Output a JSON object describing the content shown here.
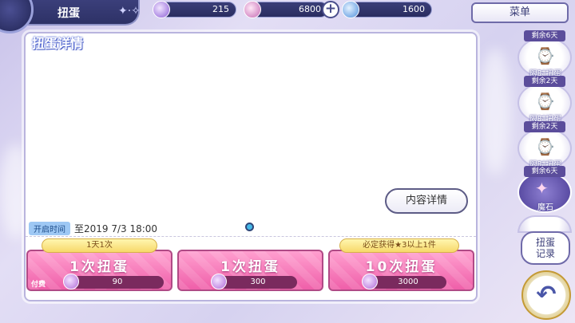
{
  "header": {
    "title": "扭蛋",
    "currencies": [
      {
        "name": "stone",
        "value": "215",
        "color": "#a97ee0"
      },
      {
        "name": "jewel",
        "value": "6800",
        "color": "#d58ec5"
      },
      {
        "name": "potion",
        "value": "1600",
        "color": "#6ea8e6"
      }
    ],
    "menu_label": "菜单"
  },
  "panel": {
    "title": "扭蛋详情",
    "details_button": "内容详情",
    "period_tag": "开启时间",
    "period_text": "至2019 7/3 18:00"
  },
  "gacha": {
    "single_daily": {
      "ribbon": "1天1次",
      "label": "1次扭蛋",
      "pay_tag": "付费",
      "cost": "90"
    },
    "single": {
      "label": "1次扭蛋",
      "cost": "300"
    },
    "ten": {
      "ribbon": "必定获得★3以上1件",
      "label": "10次扭蛋",
      "cost": "3000"
    }
  },
  "sidebar": {
    "items": [
      {
        "badge": "剩余6天",
        "label": "限时扭蛋",
        "icon": "clock-icon"
      },
      {
        "badge": "剩余2天",
        "label": "限时扭蛋",
        "icon": "clock-icon"
      },
      {
        "badge": "剩余2天",
        "label": "限时扭蛋",
        "icon": "clock-icon"
      },
      {
        "badge": "剩余6天",
        "label": "魔石",
        "icon": "magic-stone-icon"
      }
    ],
    "record_label_1": "扭蛋",
    "record_label_2": "记录",
    "back_icon": "↶"
  },
  "accent_color": "#ef5fa9"
}
